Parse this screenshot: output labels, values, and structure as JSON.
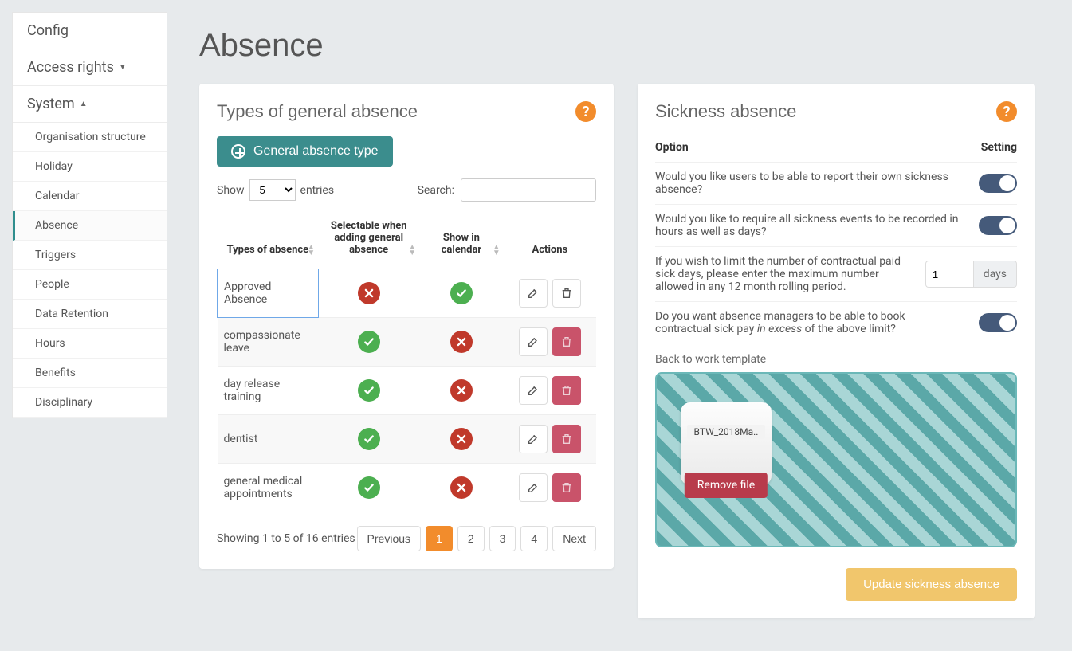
{
  "sidebar": {
    "items": [
      {
        "label": "Config",
        "type": "heading",
        "key": "config"
      },
      {
        "label": "Access rights",
        "type": "heading",
        "caret": "down",
        "key": "access-rights"
      },
      {
        "label": "System",
        "type": "heading",
        "caret": "up",
        "key": "system"
      },
      {
        "label": "Organisation structure",
        "type": "sub",
        "key": "org-structure"
      },
      {
        "label": "Holiday",
        "type": "sub",
        "key": "holiday"
      },
      {
        "label": "Calendar",
        "type": "sub",
        "key": "calendar"
      },
      {
        "label": "Absence",
        "type": "sub",
        "key": "absence",
        "active": true
      },
      {
        "label": "Triggers",
        "type": "sub",
        "key": "triggers"
      },
      {
        "label": "People",
        "type": "sub",
        "key": "people"
      },
      {
        "label": "Data Retention",
        "type": "sub",
        "key": "data-retention"
      },
      {
        "label": "Hours",
        "type": "sub",
        "key": "hours"
      },
      {
        "label": "Benefits",
        "type": "sub",
        "key": "benefits"
      },
      {
        "label": "Disciplinary",
        "type": "sub",
        "key": "disciplinary"
      }
    ]
  },
  "page": {
    "title": "Absence"
  },
  "general": {
    "card_title": "Types of general absence",
    "add_button": "General absence type",
    "show_label": "Show",
    "entries_label": "entries",
    "page_size": "5",
    "search_label": "Search:",
    "search_value": "",
    "columns": {
      "types": "Types of absence",
      "selectable": "Selectable when adding general absence",
      "show_calendar": "Show in calendar",
      "actions": "Actions"
    },
    "rows": [
      {
        "name": "Approved Absence",
        "selectable": false,
        "show_calendar": true,
        "delete_enabled": true,
        "selected": true
      },
      {
        "name": "compassionate leave",
        "selectable": true,
        "show_calendar": false,
        "delete_enabled": false
      },
      {
        "name": "day release training",
        "selectable": true,
        "show_calendar": false,
        "delete_enabled": false
      },
      {
        "name": "dentist",
        "selectable": true,
        "show_calendar": false,
        "delete_enabled": false
      },
      {
        "name": "general medical appointments",
        "selectable": true,
        "show_calendar": false,
        "delete_enabled": false
      }
    ],
    "footer_info": "Showing 1 to 5 of 16 entries",
    "pagination": {
      "prev": "Previous",
      "pages": [
        "1",
        "2",
        "3",
        "4"
      ],
      "next": "Next",
      "active": "1"
    }
  },
  "sickness": {
    "card_title": "Sickness absence",
    "header_option": "Option",
    "header_setting": "Setting",
    "options": [
      {
        "text": "Would you like users to be able to report their own sickness absence?",
        "type": "toggle",
        "value": true
      },
      {
        "text": "Would you like to require all sickness events to be recorded in hours as well as days?",
        "type": "toggle",
        "value": true
      },
      {
        "text": "If you wish to limit the number of contractual paid sick days, please enter the maximum number allowed in any 12 month rolling period.",
        "type": "number",
        "value": "1",
        "suffix": "days"
      },
      {
        "text_pre": "Do you want absence managers to be able to book contractual sick pay ",
        "text_em": "in excess",
        "text_post": " of the above limit?",
        "type": "toggle",
        "value": true
      }
    ],
    "template_label": "Back to work template",
    "file_name": "BTW_2018Ma..",
    "remove_label": "Remove file",
    "update_button": "Update sickness absence"
  }
}
